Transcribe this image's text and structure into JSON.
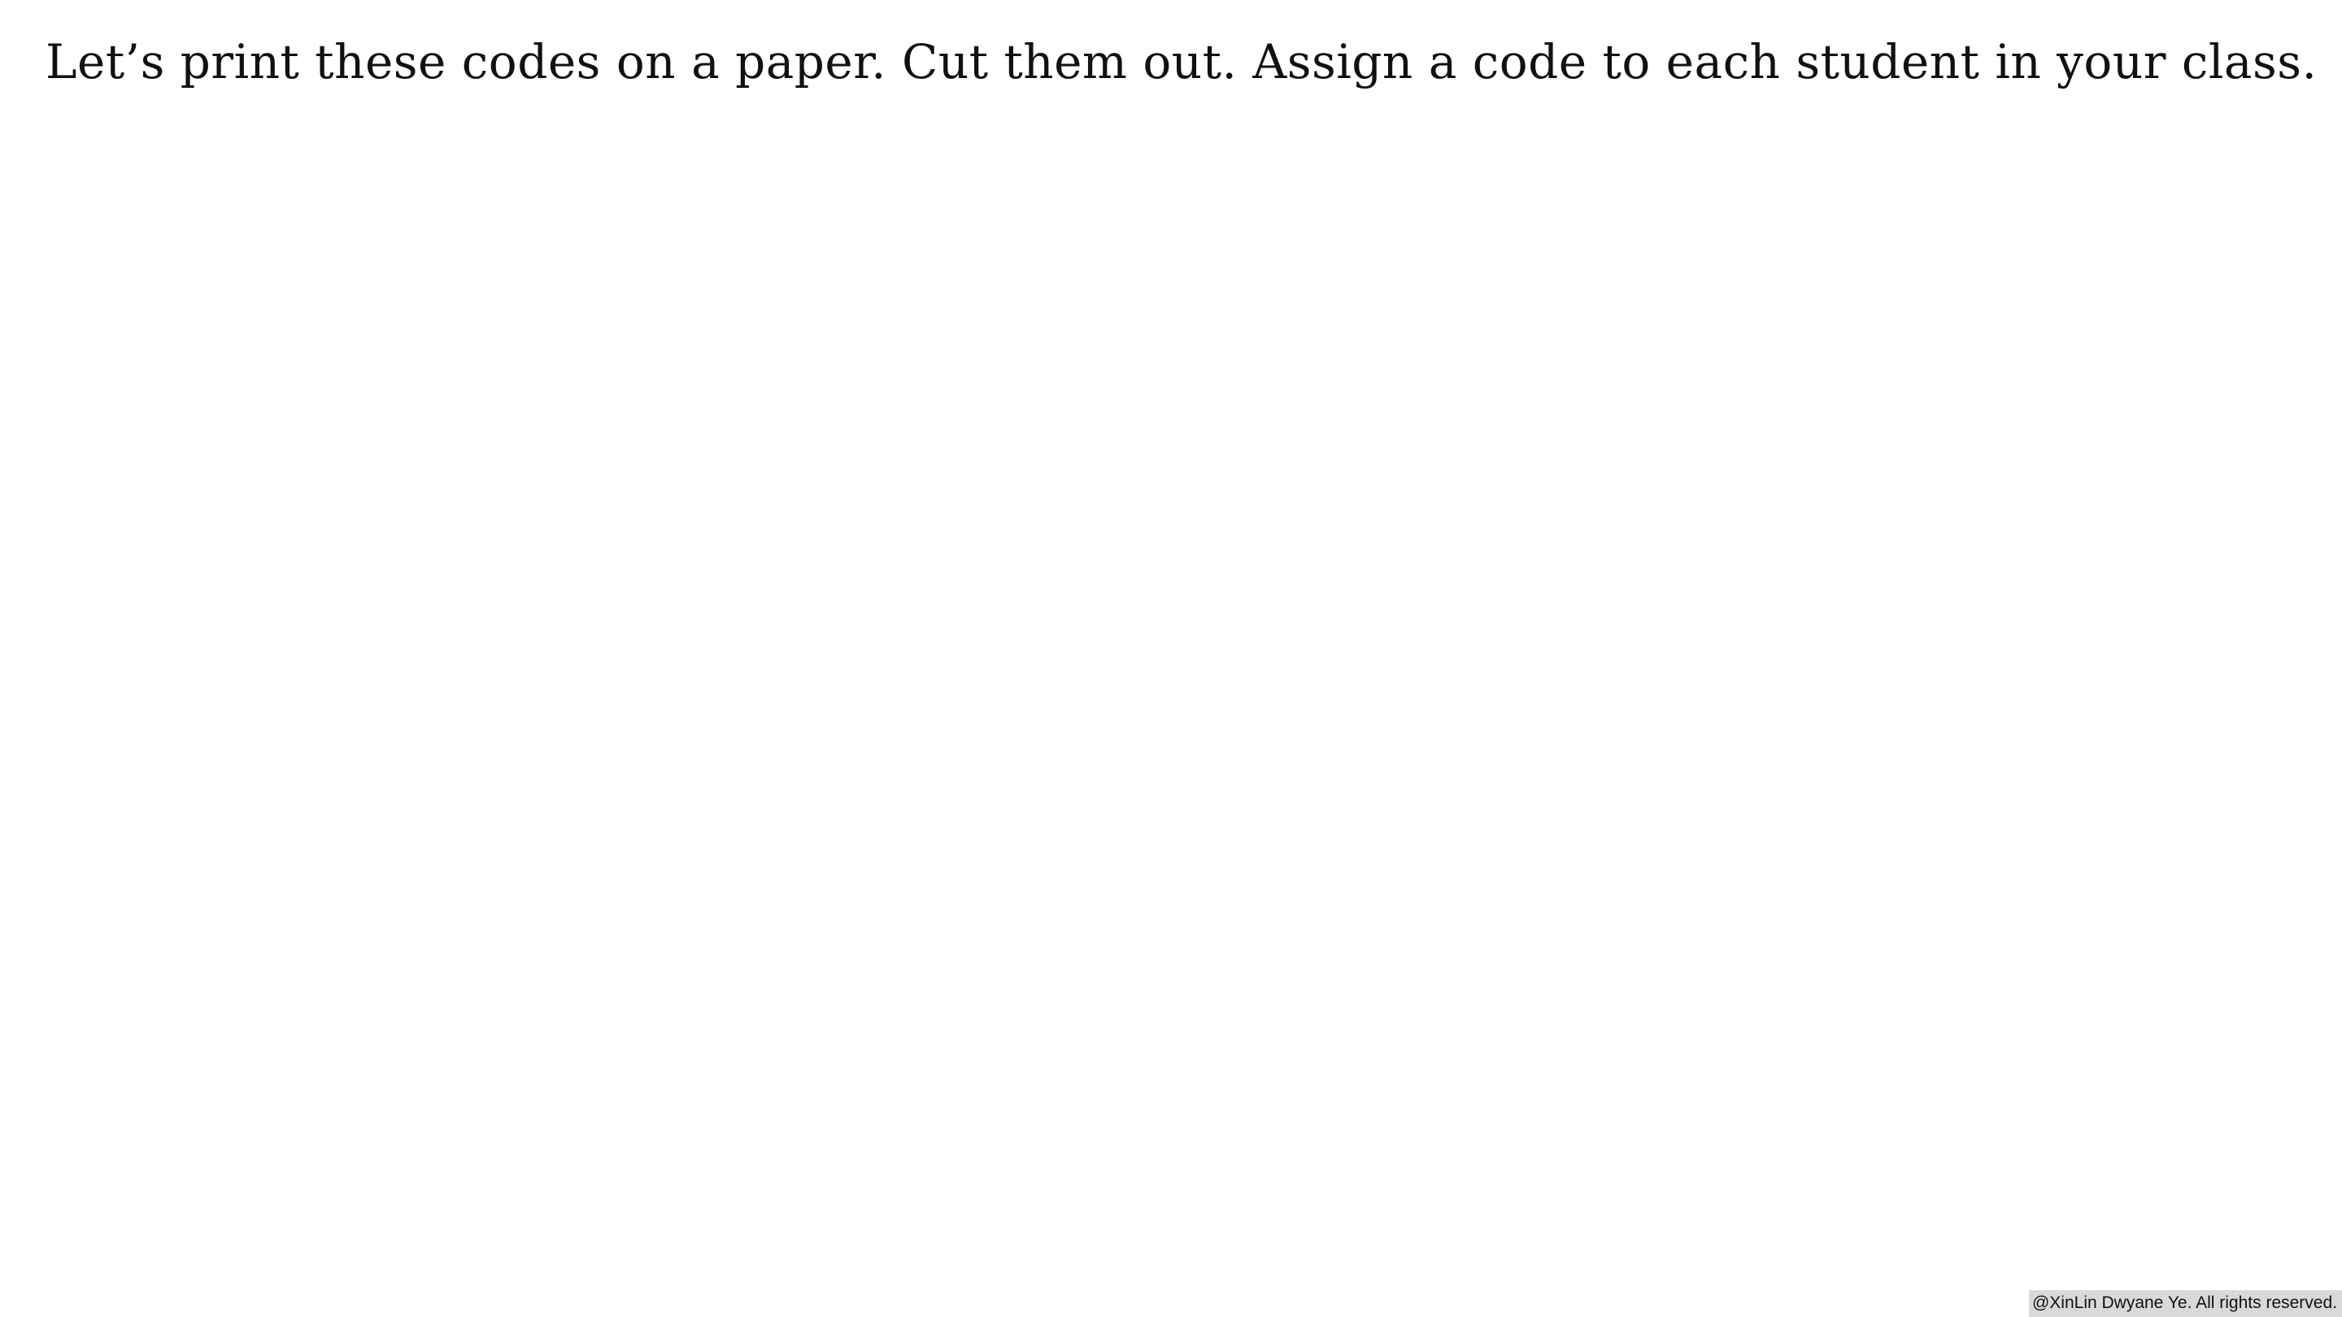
{
  "slide": {
    "instruction": "Let’s print these codes on a paper. Cut them out. Assign a code to each student in your class.",
    "copyright": "@XinLin Dwyane Ye. All rights reserved."
  }
}
